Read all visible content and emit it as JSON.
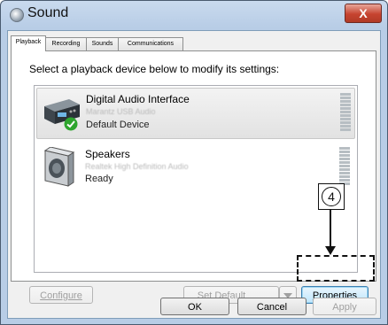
{
  "window": {
    "title": "Sound",
    "close_label": "X"
  },
  "tabs": [
    {
      "label": "Playback",
      "active": true
    },
    {
      "label": "Recording",
      "active": false
    },
    {
      "label": "Sounds",
      "active": false
    },
    {
      "label": "Communications",
      "active": false
    }
  ],
  "instruction": "Select a playback device below to modify its settings:",
  "devices": [
    {
      "name": "Digital Audio Interface",
      "sub": "Marantz USB Audio",
      "status": "Default Device",
      "selected": true
    },
    {
      "name": "Speakers",
      "sub": "Realtek High Definition Audio",
      "status": "Ready",
      "selected": false
    }
  ],
  "buttons": {
    "configure": "Configure",
    "set_default": "Set Default",
    "properties": "Properties",
    "ok": "OK",
    "cancel": "Cancel",
    "apply": "Apply"
  },
  "callout": {
    "step": "4"
  },
  "colors": {
    "callout": "#111111",
    "check": "#2ea52e",
    "selected_bg": "#e6e6e6"
  }
}
